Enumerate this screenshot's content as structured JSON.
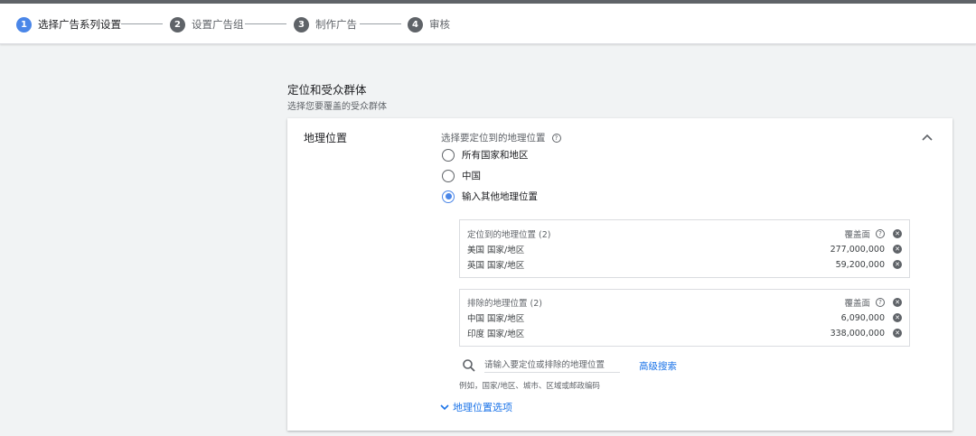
{
  "stepper": {
    "steps": [
      {
        "number": "1",
        "label": "选择广告系列设置",
        "active": true
      },
      {
        "number": "2",
        "label": "设置广告组",
        "active": false
      },
      {
        "number": "3",
        "label": "制作广告",
        "active": false
      },
      {
        "number": "4",
        "label": "审核",
        "active": false
      }
    ]
  },
  "section": {
    "title": "定位和受众群体",
    "subtitle": "选择您要覆盖的受众群体"
  },
  "geo": {
    "card_label": "地理位置",
    "question": "选择要定位到的地理位置",
    "options": [
      {
        "label": "所有国家和地区",
        "checked": false
      },
      {
        "label": "中国",
        "checked": false
      },
      {
        "label": "输入其他地理位置",
        "checked": true
      }
    ],
    "targeted": {
      "header": "定位到的地理位置 (2)",
      "reach_label": "覆盖面",
      "rows": [
        {
          "name": "美国 国家/地区",
          "reach": "277,000,000"
        },
        {
          "name": "英国 国家/地区",
          "reach": "59,200,000"
        }
      ]
    },
    "excluded": {
      "header": "排除的地理位置 (2)",
      "reach_label": "覆盖面",
      "rows": [
        {
          "name": "中国 国家/地区",
          "reach": "6,090,000"
        },
        {
          "name": "印度 国家/地区",
          "reach": "338,000,000"
        }
      ]
    },
    "search_placeholder": "请输入要定位或排除的地理位置",
    "advanced_search": "高级搜索",
    "example": "例如，国家/地区、城市、区域或邮政编码",
    "location_options": "地理位置选项"
  }
}
